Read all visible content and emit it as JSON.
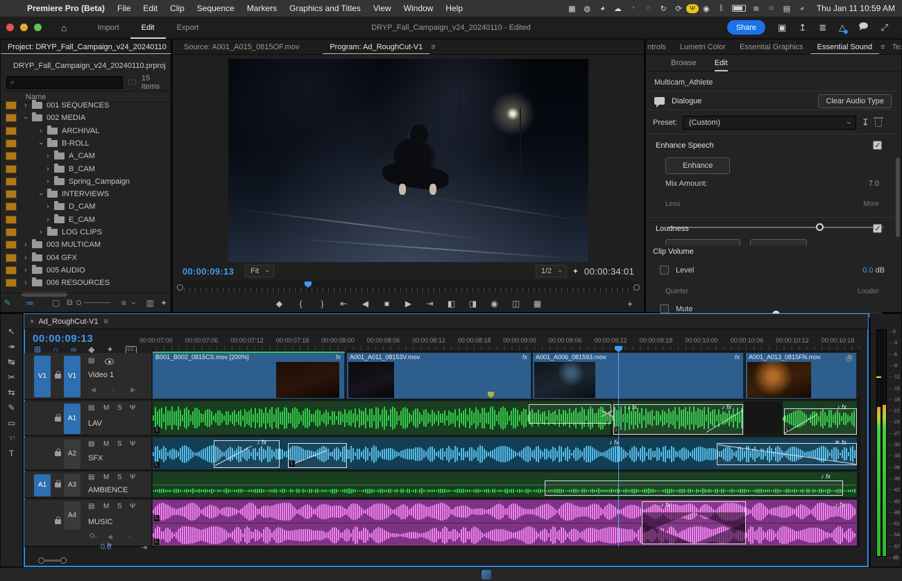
{
  "colors": {
    "accent_blue": "#3f9bf0",
    "share_blue": "#1a73e8",
    "clip_blue": "#2d5e8e",
    "waveform_green": "#35c94a",
    "waveform_cyan": "#55bce8",
    "waveform_pink": "#ef82f0",
    "meter_green": "#41d33f",
    "meter_orange": "#e8a03c",
    "bin_orange": "#b07818",
    "panel_focus": "#2d8ceb"
  },
  "menubar": {
    "app_name": "Premiere Pro (Beta)",
    "items": [
      "File",
      "Edit",
      "Clip",
      "Sequence",
      "Markers",
      "Graphics and Titles",
      "View",
      "Window",
      "Help"
    ],
    "status_icons": [
      "screen-mirror-icon",
      "privacy-lock-icon",
      "shield-check-icon",
      "cloud-sync-icon",
      "notification-dot-icon",
      "search-dim-icon",
      "update-icon",
      "restart-icon",
      "mic-active-icon",
      "play-circle-icon",
      "bluetooth-icon",
      "battery-icon",
      "wifi-icon",
      "spotlight-icon",
      "control-center-icon",
      "siri-icon"
    ],
    "clock": "Thu Jan 11  10:59 AM"
  },
  "titlebar": {
    "mode_tabs": [
      {
        "label": "Import"
      },
      {
        "label": "Edit"
      },
      {
        "label": "Export"
      }
    ],
    "active_mode": "Edit",
    "document_title": "DRYP_Fall_Campaign_v24_20240110 - Edited",
    "share_label": "Share",
    "right_icons": [
      "workspaces-icon",
      "quick-export-icon",
      "workspace-settings-icon",
      "beta-feedback-icon",
      "comments-icon",
      "fullscreen-icon"
    ]
  },
  "project": {
    "tab_label": "Project: DRYP_Fall_Campaign_v24_20240110",
    "overflow_indicator": "»",
    "file_name": "DRYP_Fall_Campaign_v24_20240110.prproj",
    "items_count": "15 items",
    "name_column": "Name",
    "tree": [
      {
        "label": "001 SEQUENCES",
        "level": 0,
        "expanded": false
      },
      {
        "label": "002 MEDIA",
        "level": 0,
        "expanded": true
      },
      {
        "label": "ARCHIVAL",
        "level": 1,
        "expanded": false
      },
      {
        "label": "B-ROLL",
        "level": 1,
        "expanded": true
      },
      {
        "label": "A_CAM",
        "level": 2,
        "expanded": false
      },
      {
        "label": "B_CAM",
        "level": 2,
        "expanded": false
      },
      {
        "label": "Spring_Campaign",
        "level": 2,
        "expanded": false
      },
      {
        "label": "INTERVIEWS",
        "level": 1,
        "expanded": true
      },
      {
        "label": "D_CAM",
        "level": 2,
        "expanded": false
      },
      {
        "label": "E_CAM",
        "level": 2,
        "expanded": false
      },
      {
        "label": "LOG CLIPS",
        "level": 1,
        "expanded": false
      },
      {
        "label": "003 MULTICAM",
        "level": 0,
        "expanded": false
      },
      {
        "label": "004 GFX",
        "level": 0,
        "expanded": false
      },
      {
        "label": "005 AUDIO",
        "level": 0,
        "expanded": false
      },
      {
        "label": "006 RESOURCES",
        "level": 0,
        "expanded": false
      }
    ]
  },
  "monitor": {
    "source_tab": "Source: A001_A015_0815OF.mov",
    "program_tab": "Program: Ad_RoughCut-V1",
    "timecode": "00:00:09:13",
    "zoom_level": "Fit",
    "playback_resolution": "1/2",
    "duration": "00:00:34:01",
    "transport": [
      {
        "name": "add-marker-icon",
        "glyph": "◆"
      },
      {
        "name": "mark-in-icon",
        "glyph": "{"
      },
      {
        "name": "mark-out-icon",
        "glyph": "}"
      },
      {
        "name": "go-to-in-icon",
        "glyph": "⇤"
      },
      {
        "name": "step-back-icon",
        "glyph": "◀"
      },
      {
        "name": "play-stop-icon",
        "glyph": "■"
      },
      {
        "name": "step-forward-icon",
        "glyph": "▶"
      },
      {
        "name": "go-to-out-icon",
        "glyph": "⇥"
      },
      {
        "name": "lift-icon",
        "glyph": "◧"
      },
      {
        "name": "extract-icon",
        "glyph": "◨"
      },
      {
        "name": "export-frame-icon",
        "glyph": "◉"
      },
      {
        "name": "comparison-view-icon",
        "glyph": "◫"
      },
      {
        "name": "multicam-toggle-icon",
        "glyph": "▦"
      }
    ]
  },
  "essential_sound": {
    "tabs": [
      {
        "label": "ntrols"
      },
      {
        "label": "Lumetri Color"
      },
      {
        "label": "Essential Graphics"
      },
      {
        "label": "Essential Sound"
      },
      {
        "label": "Text"
      }
    ],
    "active_tab": "Essential Sound",
    "overflow_indicator": "»",
    "subtabs": [
      {
        "label": "Browse"
      },
      {
        "label": "Edit"
      }
    ],
    "active_subtab": "Edit",
    "clip_name": "Multicam_Athlete",
    "audio_type": "Dialogue",
    "clear_button": "Clear Audio Type",
    "preset_label": "Preset:",
    "preset_value": "(Custom)",
    "enhance_speech": {
      "label": "Enhance Speech",
      "checked": true,
      "button": "Enhance",
      "mix_label": "Mix Amount:",
      "mix_value": "7.0",
      "min": "Less",
      "max": "More"
    },
    "loudness": {
      "label": "Loudness",
      "checked": true
    },
    "clip_volume": {
      "header": "Clip Volume",
      "level_label": "Level",
      "level_value": "0.0",
      "level_unit": "dB",
      "min": "Quieter",
      "max": "Louder",
      "mute_label": "Mute"
    }
  },
  "tools": [
    {
      "name": "selection-tool",
      "glyph": "↖"
    },
    {
      "name": "track-select-tool",
      "glyph": "↠"
    },
    {
      "name": "ripple-edit-tool",
      "glyph": "↹"
    },
    {
      "name": "razor-tool",
      "glyph": "✂"
    },
    {
      "name": "slip-tool",
      "glyph": "⇆"
    },
    {
      "name": "pen-tool",
      "glyph": "✎"
    },
    {
      "name": "rectangle-tool",
      "glyph": "▭"
    },
    {
      "name": "hand-tool",
      "glyph": "☜"
    },
    {
      "name": "type-tool",
      "glyph": "T"
    }
  ],
  "timeline": {
    "tab_label": "Ad_RoughCut-V1",
    "close_glyph": "×",
    "timecode": "00:00:09:13",
    "ruler": [
      "00:00:07:00",
      "00:00:07:06",
      "00:00:07:12",
      "00:00:07:18",
      "00:00:08:00",
      "00:00:08:06",
      "00:00:08:12",
      "00:00:08:18",
      "00:00:09:00",
      "00:00:09:06",
      "00:00:09:12",
      "00:00:09:18",
      "00:00:10:00",
      "00:00:10:06",
      "00:00:10:12",
      "00:00:10:18"
    ],
    "tracks": [
      {
        "source": "V1",
        "target": "V1",
        "name": "Video 1"
      },
      {
        "source": "",
        "target": "A1",
        "name": "LAV"
      },
      {
        "source": "",
        "target": "A2",
        "name": "SFX"
      },
      {
        "source": "A1",
        "target": "A3",
        "name": "AMBIENCE"
      },
      {
        "source": "",
        "target": "A4",
        "name": "MUSIC"
      }
    ],
    "video_clips": [
      {
        "name": "B001_B002_0815CS.mov [200%]"
      },
      {
        "name": "A001_A011_08153V.mov"
      },
      {
        "name": "A001_A006_081593.mov"
      },
      {
        "name": "A001_A013_0815FN.mov"
      }
    ],
    "fx_label": "fx",
    "channel_badge_1": "1",
    "channel_badge_L": "L",
    "note_glyph": "♪",
    "footer_gain": "0.0"
  },
  "meters": {
    "scale": [
      "0",
      "-3",
      "-6",
      "-9",
      "-12",
      "-15",
      "-18",
      "-21",
      "-24",
      "-27",
      "-30",
      "-33",
      "-36",
      "-39",
      "-42",
      "-45",
      "-48",
      "-51",
      "-54",
      "-57",
      "dB"
    ]
  }
}
